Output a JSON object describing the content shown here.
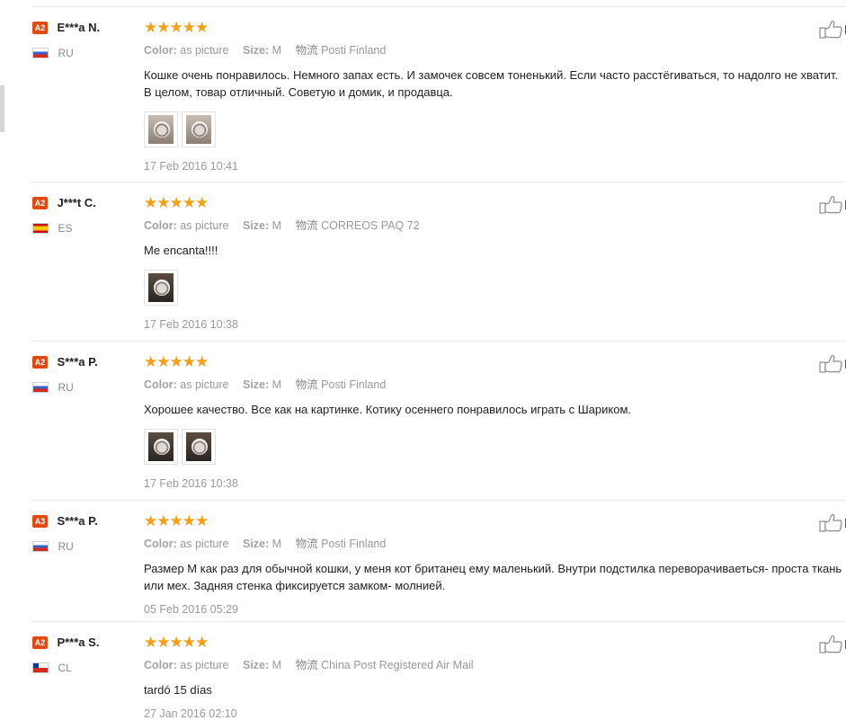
{
  "reviews": [
    {
      "level": "A2",
      "user": "E***a N.",
      "country": "RU",
      "flag": "ru",
      "stars": "★★★★★",
      "color_label": "Color:",
      "color_value": "as picture",
      "size_label": "Size:",
      "size_value": "M",
      "logistics_label": "物流",
      "logistics_value": "Posti Finland",
      "text": "Кошке очень понравилось. Немного запах есть. И замочек совсем тоненький. Если часто расстёгиваться, то надолго не хватит. В целом, товар отличный. Советую и домик, и продавца.",
      "photos": 2,
      "date": "17 Feb 2016 10:41"
    },
    {
      "level": "A2",
      "user": "J***t C.",
      "country": "ES",
      "flag": "es",
      "stars": "★★★★★",
      "color_label": "Color:",
      "color_value": "as picture",
      "size_label": "Size:",
      "size_value": "M",
      "logistics_label": "物流",
      "logistics_value": "CORREOS PAQ 72",
      "text": "Me encanta!!!!",
      "photos": 1,
      "date": "17 Feb 2016 10:38"
    },
    {
      "level": "A2",
      "user": "S***a P.",
      "country": "RU",
      "flag": "ru",
      "stars": "★★★★★",
      "color_label": "Color:",
      "color_value": "as picture",
      "size_label": "Size:",
      "size_value": "M",
      "logistics_label": "物流",
      "logistics_value": "Posti Finland",
      "text": "Хорошее качество. Все как на картинке. Котику осеннего понравилось играть с Шариком.",
      "photos": 2,
      "date": "17 Feb 2016 10:38"
    },
    {
      "level": "A3",
      "user": "S***a P.",
      "country": "RU",
      "flag": "ru",
      "stars": "★★★★★",
      "color_label": "Color:",
      "color_value": "as picture",
      "size_label": "Size:",
      "size_value": "M",
      "logistics_label": "物流",
      "logistics_value": "Posti Finland",
      "text": "Размер М как раз для обычной кошки, у меня кот британец ему маленький. Внутри подстилка переворачиваеться- проста ткань или мех. Задняя стенка фиксируется замком- молнией.",
      "photos": 0,
      "date": "05 Feb 2016 05:29"
    },
    {
      "level": "A2",
      "user": "P***a S.",
      "country": "CL",
      "flag": "cl",
      "stars": "★★★★★",
      "color_label": "Color:",
      "color_value": "as picture",
      "size_label": "Size:",
      "size_value": "M",
      "logistics_label": "物流",
      "logistics_value": "China Post Registered Air Mail",
      "text": "tardó 15 días",
      "photos": 0,
      "date": "27 Jan 2016 02:10"
    }
  ],
  "icons": {
    "like": "thumbs-up-icon"
  },
  "colors": {
    "badge": "#e24a12",
    "stars": "#f3a018"
  }
}
